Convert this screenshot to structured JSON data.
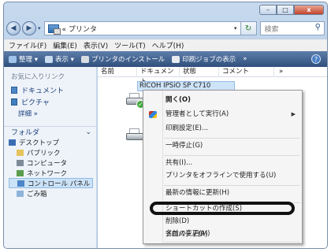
{
  "window": {
    "controls": [
      "–",
      "□",
      "x"
    ]
  },
  "address_bar": {
    "path": "« プリンタ",
    "search_placeholder": "検索"
  },
  "menubar": [
    "ファイル(F)",
    "編集(E)",
    "表示(V)",
    "ツール(T)",
    "ヘルプ(H)"
  ],
  "toolbar": [
    "整理 ▾",
    "表示 ▾",
    "プリンタのインストール",
    "印刷ジョブの表示",
    "»"
  ],
  "nav": {
    "favorites_header": "お気に入りリンク",
    "favorites": [
      "ドキュメント",
      "ピクチャ"
    ],
    "more": "詳細  »",
    "folder_header": "フォルダ",
    "tree": [
      {
        "label": "デスクトップ",
        "level": 1
      },
      {
        "label": "パブリック",
        "level": 2
      },
      {
        "label": "コンピュータ",
        "level": 2
      },
      {
        "label": "ネットワーク",
        "level": 2
      },
      {
        "label": "コントロール パネル",
        "level": 2,
        "selected": true
      },
      {
        "label": "ごみ箱",
        "level": 2
      }
    ]
  },
  "columns": [
    "名前",
    "ドキュメント",
    "状態",
    "コメント",
    "»"
  ],
  "selected_printer": "RICOH IPSiO SP C710",
  "context_menu": {
    "items": [
      {
        "label": "開く(O)",
        "bold": true
      },
      {
        "label": "管理者として実行(A)",
        "submenu": true,
        "icon": "shield-icon"
      },
      {
        "label": "印刷設定(E)..."
      },
      {
        "label": "一時停止(G)"
      },
      {
        "label": "共有(I)..."
      },
      {
        "label": "プリンタをオフラインで使用する(U)"
      },
      {
        "label": "最新の情報に更新(H)"
      },
      {
        "label": "ショートカットの作成(S)"
      },
      {
        "label": "削除(D)",
        "highlighted": true
      },
      {
        "label": "名前の変更(M)"
      },
      {
        "label": "プロパティ(R)"
      }
    ]
  }
}
